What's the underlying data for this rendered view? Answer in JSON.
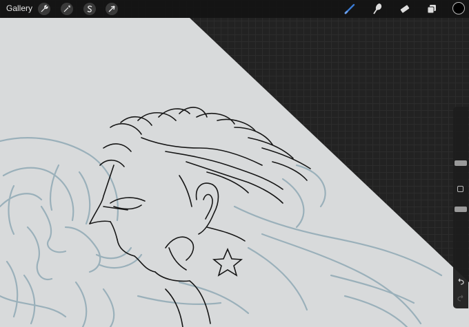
{
  "topbar": {
    "gallery_label": "Gallery",
    "left_tools": [
      {
        "name": "actions",
        "icon": "wrench-icon"
      },
      {
        "name": "adjustments",
        "icon": "magic-wand-icon"
      },
      {
        "name": "selection",
        "icon": "selection-s-icon"
      },
      {
        "name": "transform",
        "icon": "arrow-cursor-icon"
      }
    ],
    "right_tools": [
      {
        "name": "brush",
        "icon": "brush-icon",
        "active": true
      },
      {
        "name": "smudge",
        "icon": "smudge-icon",
        "active": false
      },
      {
        "name": "eraser",
        "icon": "eraser-icon",
        "active": false
      },
      {
        "name": "layers",
        "icon": "layers-icon",
        "active": false
      }
    ],
    "current_color": "#000000"
  },
  "colors": {
    "accent": "#3a7bd5",
    "canvas_paper": "#d8dadb",
    "sketch_blue": "#9ab0ba",
    "ink": "#151515"
  },
  "sidebar": {
    "brush_size_level": 0.28,
    "opacity_level": 0.5,
    "buttons": [
      "undo-icon",
      "redo-icon"
    ]
  }
}
